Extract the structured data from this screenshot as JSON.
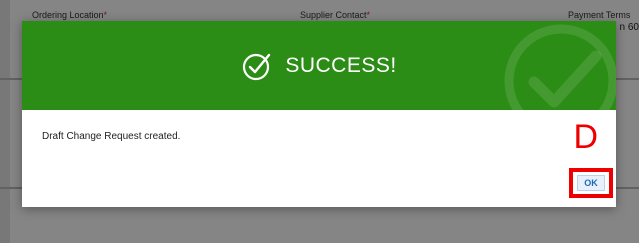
{
  "background_form": {
    "ordering_location_label": "Ordering Location",
    "supplier_contact_label": "Supplier Contact",
    "payment_terms_label": "Payment Terms",
    "required_marker": "*",
    "payment_terms_value_partial": "n 60"
  },
  "modal": {
    "title": "SUCCESS!",
    "message": "Draft Change Request created.",
    "ok_label": "OK",
    "header_color": "#2b8d15",
    "icon": "check-circle-icon"
  },
  "annotation": {
    "letter": "D",
    "color": "#ee0000"
  }
}
